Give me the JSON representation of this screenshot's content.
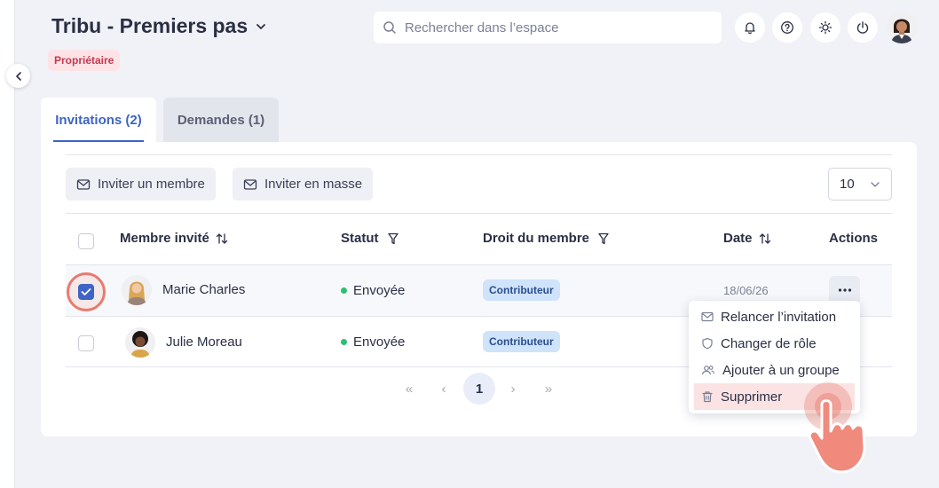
{
  "header": {
    "space_title": "Tribu - Premiers pas",
    "owner_badge": "Propriétaire",
    "search_placeholder": "Rechercher dans l’espace"
  },
  "top_icons": [
    "bell-icon",
    "help-icon",
    "sun-icon",
    "power-icon"
  ],
  "tabs": [
    {
      "label": "Invitations (2)",
      "active": true
    },
    {
      "label": "Demandes (1)",
      "active": false
    }
  ],
  "toolbar": {
    "invite_member": "Inviter un membre",
    "invite_bulk": "Inviter en masse",
    "page_size": "10"
  },
  "table": {
    "columns": {
      "member": "Membre invité",
      "status": "Statut",
      "role": "Droit du membre",
      "date": "Date",
      "actions": "Actions"
    },
    "rows": [
      {
        "name": "Marie Charles",
        "status": "Envoyée",
        "role": "Contributeur",
        "date": "18/06/26",
        "selected": true
      },
      {
        "name": "Julie Moreau",
        "status": "Envoyée",
        "role": "Contributeur",
        "date": "",
        "selected": false
      }
    ]
  },
  "pagination": {
    "first": "«",
    "prev": "‹",
    "current": "1",
    "next": "›",
    "last": "»"
  },
  "action_menu": {
    "items": [
      {
        "label": "Relancer l’invitation",
        "icon": "mail-icon"
      },
      {
        "label": "Changer de rôle",
        "icon": "shield-icon"
      },
      {
        "label": "Ajouter à un groupe",
        "icon": "group-icon"
      },
      {
        "label": "Supprimer",
        "icon": "trash-icon",
        "highlighted": true
      }
    ]
  },
  "colors": {
    "accent": "#3e64c6",
    "owner_badge_bg": "#fde3e6",
    "role_badge_bg": "#cfe3fb",
    "status_dot": "#2dbf73",
    "highlight": "#e97a6e"
  }
}
